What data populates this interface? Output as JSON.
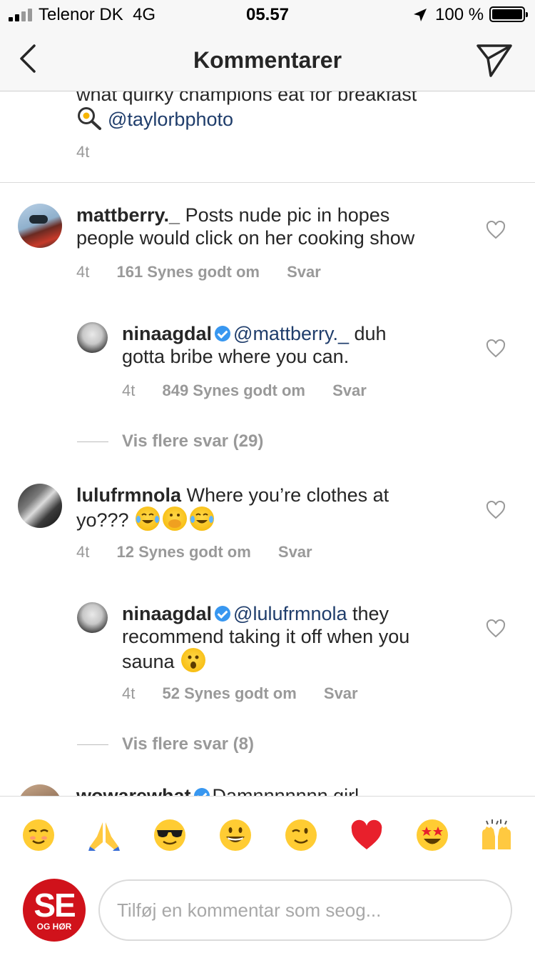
{
  "status_bar": {
    "carrier": "Telenor DK",
    "network": "4G",
    "time": "05.57",
    "battery": "100 %"
  },
  "nav": {
    "title": "Kommentarer",
    "back_icon": "chevron-left-icon",
    "send_icon": "paper-plane-icon"
  },
  "caption": {
    "partial_text": "what quirky champions eat for breakfast",
    "mention": "@taylorbphoto",
    "time": "4t"
  },
  "comments": [
    {
      "username": "mattberry._",
      "text": "Posts nude pic in hopes people would click on her cooking show",
      "line2": "people would click on her cooking show",
      "line1": "Posts nude pic in hopes",
      "time": "4t",
      "likes": "161 Synes godt om",
      "reply_label": "Svar",
      "replies": [
        {
          "username": "ninaagdal",
          "verified": true,
          "mention": "@mattberry._",
          "text_line1": " duh",
          "text_line2": "gotta bribe where you can.",
          "time": "4t",
          "likes": "849 Synes godt om",
          "reply_label": "Svar"
        }
      ],
      "more_replies": "Vis flere svar (29)"
    },
    {
      "username": "lulufrmnola",
      "line1": "Where you’re clothes at",
      "line2": "yo???",
      "time": "4t",
      "likes": "12 Synes godt om",
      "reply_label": "Svar",
      "replies": [
        {
          "username": "ninaagdal",
          "verified": true,
          "mention": "@lulufrmnola",
          "text_line1": " they",
          "text_line2": "recommend taking it off when you",
          "text_line3": "sauna",
          "time": "4t",
          "likes": "52 Synes godt om",
          "reply_label": "Svar"
        }
      ],
      "more_replies": "Vis flere svar (8)"
    },
    {
      "username": "wowarewhat",
      "text": "Damnnnnnnn girl"
    }
  ],
  "emoji_bar": [
    "smiling-face-icon",
    "folded-hands-icon",
    "sunglasses-face-icon",
    "grinning-face-icon",
    "winking-face-icon",
    "red-heart-icon",
    "star-struck-icon",
    "raising-hands-icon"
  ],
  "composer": {
    "avatar_label_main": "SE",
    "avatar_label_sub": "OG HØR",
    "placeholder": "Tilføj en kommentar som seog..."
  },
  "colors": {
    "mention": "#1f3d6b",
    "meta": "#999999",
    "verified": "#3897f0",
    "brand": "#d0121b"
  }
}
